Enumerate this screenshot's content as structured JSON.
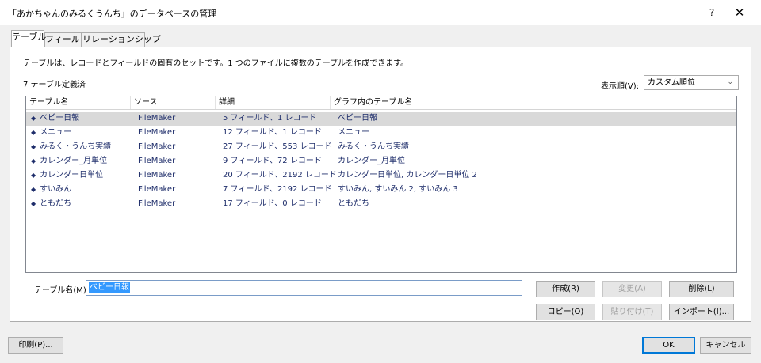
{
  "window": {
    "title": "「あかちゃんのみるくうんち」のデータベースの管理",
    "help_label": "?",
    "close_label": "✕"
  },
  "tabs": [
    {
      "label": "テーブル",
      "active": true
    },
    {
      "label": "フィールド",
      "active": false
    },
    {
      "label": "リレーションシップ",
      "active": false
    }
  ],
  "main": {
    "description": "テーブルは、レコードとフィールドの固有のセットです。1 つのファイルに複数のテーブルを作成できます。",
    "table_count": "7 テーブル定義済",
    "sort_label": "表示順(V):",
    "sort_value": "カスタム順位"
  },
  "table": {
    "headers": [
      "テーブル名",
      "ソース",
      "詳細",
      "グラフ内のテーブル名"
    ],
    "rows": [
      {
        "name": "ベビー日報",
        "source": "FileMaker",
        "details": "5 フィールド、1 レコード",
        "graph": "ベビー日報",
        "selected": true
      },
      {
        "name": "メニュー",
        "source": "FileMaker",
        "details": "12 フィールド、1 レコード",
        "graph": "メニュー",
        "selected": false
      },
      {
        "name": "みるく・うんち実績",
        "source": "FileMaker",
        "details": "27 フィールド、553 レコード",
        "graph": "みるく・うんち実績",
        "selected": false
      },
      {
        "name": "カレンダー_月単位",
        "source": "FileMaker",
        "details": "9 フィールド、72 レコード",
        "graph": "カレンダー_月単位",
        "selected": false
      },
      {
        "name": "カレンダー日単位",
        "source": "FileMaker",
        "details": "20 フィールド、2192 レコード",
        "graph": "カレンダー日単位, カレンダー日単位 2",
        "selected": false
      },
      {
        "name": "すいみん",
        "source": "FileMaker",
        "details": "7 フィールド、2192 レコード",
        "graph": "すいみん, すいみん 2, すいみん 3",
        "selected": false
      },
      {
        "name": "ともだち",
        "source": "FileMaker",
        "details": "17 フィールド、0 レコード",
        "graph": "ともだち",
        "selected": false
      }
    ],
    "bullet": "◆"
  },
  "form": {
    "name_label": "テーブル名(M):",
    "name_value": "ベビー日報"
  },
  "buttons": {
    "create": "作成(R)",
    "change": "変更(A)",
    "delete": "削除(L)",
    "copy": "コピー(O)",
    "paste": "貼り付け(T)",
    "import": "インポート(I)...",
    "print": "印刷(P)...",
    "ok": "OK",
    "cancel": "キャンセル"
  }
}
